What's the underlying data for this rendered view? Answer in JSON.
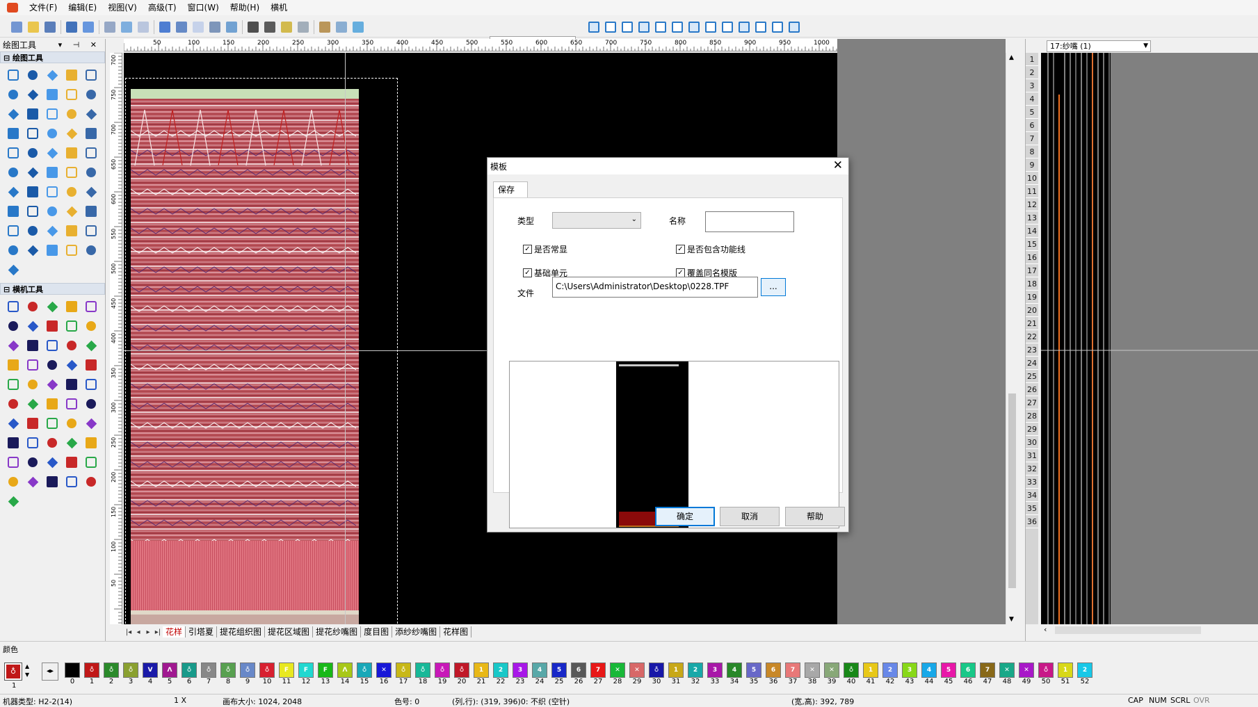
{
  "menu": [
    "文件(F)",
    "编辑(E)",
    "视图(V)",
    "高级(T)",
    "窗口(W)",
    "帮助(H)",
    "横机"
  ],
  "left_panel": {
    "title": "绘图工具",
    "controls": "▾ ⊣ ✕",
    "section_draw": "绘图工具",
    "section_machine": "横机工具"
  },
  "ruler": {
    "h_labels": [
      "50",
      "100",
      "150",
      "200",
      "250",
      "300",
      "350",
      "400",
      "450",
      "500",
      "550",
      "600",
      "650",
      "700",
      "750",
      "800",
      "850",
      "900",
      "950",
      "1000"
    ],
    "v_labels": [
      "700",
      "750",
      "700",
      "650",
      "600",
      "550",
      "500",
      "450",
      "400",
      "350",
      "300",
      "250",
      "200",
      "150",
      "100",
      "50"
    ]
  },
  "canvas_tabs": [
    "花样",
    "引塔夏",
    "提花组织图",
    "提花区域图",
    "提花纱嘴图",
    "度目图",
    "添纱纱嘴图",
    "花样图"
  ],
  "right_panel": {
    "yarn_select": "17:纱嘴 (1)",
    "row_numbers": [
      "1",
      "2",
      "3",
      "4",
      "5",
      "6",
      "7",
      "8",
      "9",
      "10",
      "11",
      "12",
      "13",
      "14",
      "15",
      "16",
      "17",
      "18",
      "19",
      "20",
      "21",
      "22",
      "23",
      "24",
      "25",
      "26",
      "27",
      "28",
      "29",
      "30",
      "31",
      "32",
      "33",
      "34",
      "35",
      "36"
    ]
  },
  "colors": {
    "title": "颜色",
    "current": "1",
    "palette": [
      {
        "n": "0",
        "c": "#000000",
        "t": ""
      },
      {
        "n": "1",
        "c": "#c01818",
        "t": "♁"
      },
      {
        "n": "2",
        "c": "#2a8a2a",
        "t": "♁"
      },
      {
        "n": "3",
        "c": "#8aa030",
        "t": "♁"
      },
      {
        "n": "4",
        "c": "#1a1aa8",
        "t": "V"
      },
      {
        "n": "5",
        "c": "#a01890",
        "t": "Λ"
      },
      {
        "n": "6",
        "c": "#189a8a",
        "t": "♁"
      },
      {
        "n": "7",
        "c": "#888888",
        "t": "♁"
      },
      {
        "n": "8",
        "c": "#58a050",
        "t": "♁"
      },
      {
        "n": "9",
        "c": "#6888c8",
        "t": "♁"
      },
      {
        "n": "10",
        "c": "#d82030",
        "t": "♁"
      },
      {
        "n": "11",
        "c": "#e8e820",
        "t": "F"
      },
      {
        "n": "12",
        "c": "#20d8d0",
        "t": "F"
      },
      {
        "n": "13",
        "c": "#18b818",
        "t": "F"
      },
      {
        "n": "14",
        "c": "#a8c818",
        "t": "Λ"
      },
      {
        "n": "15",
        "c": "#18a8b8",
        "t": "♁"
      },
      {
        "n": "16",
        "c": "#1818d8",
        "t": "✕"
      },
      {
        "n": "17",
        "c": "#c8b818",
        "t": "♁"
      },
      {
        "n": "18",
        "c": "#18b898",
        "t": "♁"
      },
      {
        "n": "19",
        "c": "#c818b8",
        "t": "♁"
      },
      {
        "n": "20",
        "c": "#c01828",
        "t": "♁"
      },
      {
        "n": "21",
        "c": "#e8b818",
        "t": "1"
      },
      {
        "n": "22",
        "c": "#18c8c8",
        "t": "2"
      },
      {
        "n": "23",
        "c": "#a818e8",
        "t": "3"
      },
      {
        "n": "24",
        "c": "#58a8a8",
        "t": "4"
      },
      {
        "n": "25",
        "c": "#1828c8",
        "t": "5"
      },
      {
        "n": "26",
        "c": "#585858",
        "t": "6"
      },
      {
        "n": "27",
        "c": "#e81818",
        "t": "7"
      },
      {
        "n": "28",
        "c": "#18b838",
        "t": "✕"
      },
      {
        "n": "29",
        "c": "#d86868",
        "t": "✕"
      },
      {
        "n": "30",
        "c": "#1818a8",
        "t": "♁"
      },
      {
        "n": "31",
        "c": "#c8a818",
        "t": "1"
      },
      {
        "n": "32",
        "c": "#18a8a8",
        "t": "2"
      },
      {
        "n": "33",
        "c": "#a818a8",
        "t": "3"
      },
      {
        "n": "34",
        "c": "#288828",
        "t": "4"
      },
      {
        "n": "35",
        "c": "#6868c8",
        "t": "5"
      },
      {
        "n": "36",
        "c": "#c88828",
        "t": "6"
      },
      {
        "n": "37",
        "c": "#e87878",
        "t": "7"
      },
      {
        "n": "38",
        "c": "#a8a8a8",
        "t": "✕"
      },
      {
        "n": "39",
        "c": "#88a878",
        "t": "✕"
      },
      {
        "n": "40",
        "c": "#188818",
        "t": "♁"
      },
      {
        "n": "41",
        "c": "#e8c818",
        "t": "1"
      },
      {
        "n": "42",
        "c": "#6888e8",
        "t": "2"
      },
      {
        "n": "43",
        "c": "#88d818",
        "t": "3"
      },
      {
        "n": "44",
        "c": "#18a8e8",
        "t": "4"
      },
      {
        "n": "45",
        "c": "#e818a8",
        "t": "5"
      },
      {
        "n": "46",
        "c": "#18c888",
        "t": "6"
      },
      {
        "n": "47",
        "c": "#886818",
        "t": "7"
      },
      {
        "n": "48",
        "c": "#18a888",
        "t": "✕"
      },
      {
        "n": "49",
        "c": "#a818c8",
        "t": "✕"
      },
      {
        "n": "50",
        "c": "#c81888",
        "t": "♁"
      },
      {
        "n": "51",
        "c": "#d8d818",
        "t": "1"
      },
      {
        "n": "52",
        "c": "#18c8e8",
        "t": "2"
      }
    ]
  },
  "status": {
    "machine": "机器类型: H2-2(14)",
    "zoom": "1 X",
    "canvas_size": "画布大小: 1024, 2048",
    "color_no": "色号: 0",
    "position": "(列,行): (319, 396)0: 不织 (空针)",
    "size": "(宽,高): 392, 789",
    "indicators": [
      "CAP",
      "NUM",
      "SCRL",
      "OVR"
    ]
  },
  "dialog": {
    "title": "模板",
    "tab": "保存",
    "type_label": "类型",
    "type_value": "",
    "name_label": "名称",
    "name_value": "",
    "chk_common": "是否常显",
    "chk_func_line": "是否包含功能线",
    "chk_basic_unit": "基础单元",
    "chk_overwrite": "覆盖同名模版",
    "file_label": "文件",
    "file_path": "C:\\Users\\Administrator\\Desktop\\0228.TPF",
    "browse": "...",
    "ok": "确定",
    "cancel": "取消",
    "help": "帮助"
  }
}
